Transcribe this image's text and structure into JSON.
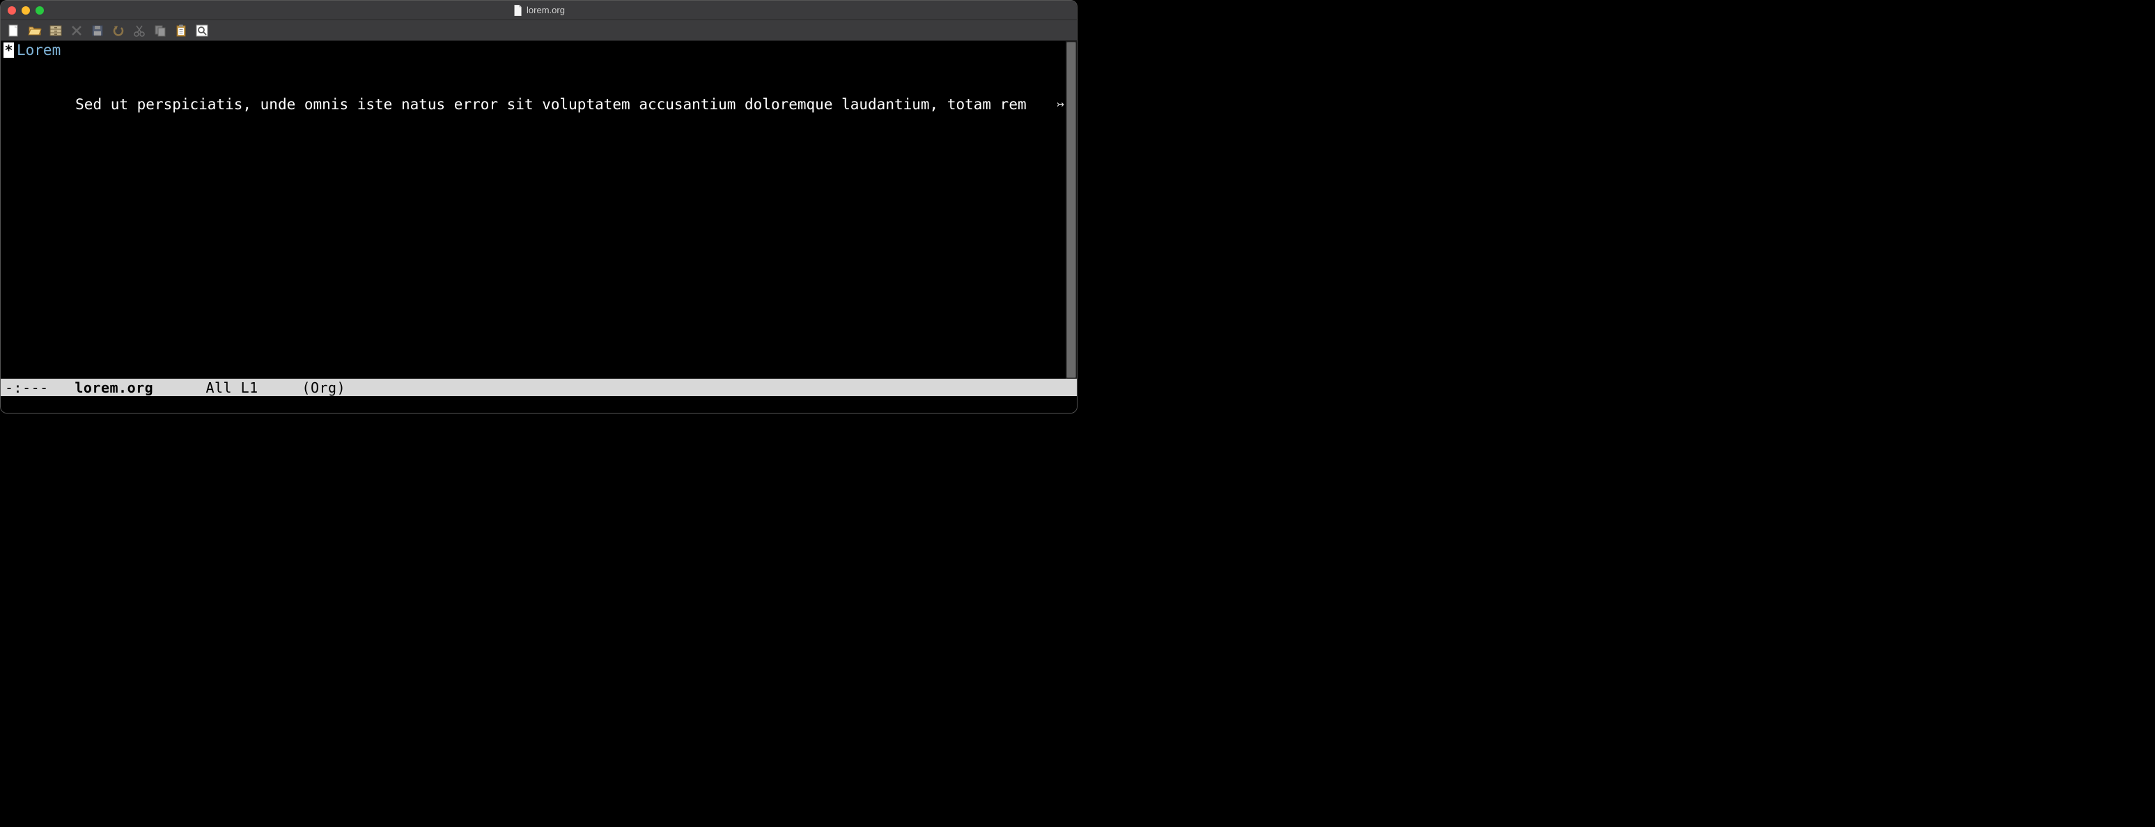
{
  "window": {
    "title": "lorem.org"
  },
  "toolbar": {
    "new_file": "New File",
    "open": "Open",
    "dired": "Directory",
    "close": "Close",
    "save": "Save",
    "undo": "Undo",
    "cut": "Cut",
    "copy": "Copy",
    "paste": "Paste",
    "search": "Search"
  },
  "buffer": {
    "heading_star": "*",
    "heading_text": " Lorem",
    "body_line": "Sed ut perspiciatis, unde omnis iste natus error sit voluptatem accusantium doloremque laudantium, totam rem",
    "truncation_glyph": "↣"
  },
  "modeline": {
    "status": "-:--- ",
    "buffer_name": "  lorem.org   ",
    "position": "   All L1   ",
    "mode": "  (Org)"
  }
}
